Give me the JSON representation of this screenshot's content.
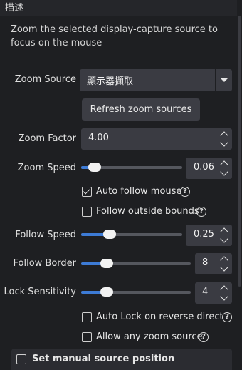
{
  "header": {
    "title": "描述"
  },
  "description": "Zoom the selected display-capture source to focus on the mouse",
  "zoom_source": {
    "label": "Zoom Source",
    "value": "顯示器擷取"
  },
  "refresh_button": "Refresh zoom sources",
  "zoom_factor": {
    "label": "Zoom Factor",
    "value": "4.00"
  },
  "zoom_speed": {
    "label": "Zoom Speed",
    "value": "0.06",
    "fraction": 0.08
  },
  "auto_follow": {
    "label": "Auto follow mouse",
    "checked": true
  },
  "follow_outside": {
    "label": "Follow outside bounds",
    "checked": false
  },
  "follow_speed": {
    "label": "Follow Speed",
    "value": "0.25",
    "fraction": 0.25
  },
  "follow_border": {
    "label": "Follow Border",
    "value": "8",
    "fraction": 0.2
  },
  "lock_sensitivity": {
    "label": "Lock Sensitivity",
    "value": "4",
    "fraction": 0.2
  },
  "auto_lock": {
    "label": "Auto Lock on reverse directio",
    "checked": false
  },
  "allow_any": {
    "label": "Allow any zoom source",
    "checked": false
  },
  "manual_position": {
    "label": "Set manual source position",
    "checked": false
  },
  "icons": {
    "help": "?"
  },
  "colors": {
    "accent": "#3d7bd6",
    "background": "#1e1f22",
    "control": "#3a3b42"
  }
}
